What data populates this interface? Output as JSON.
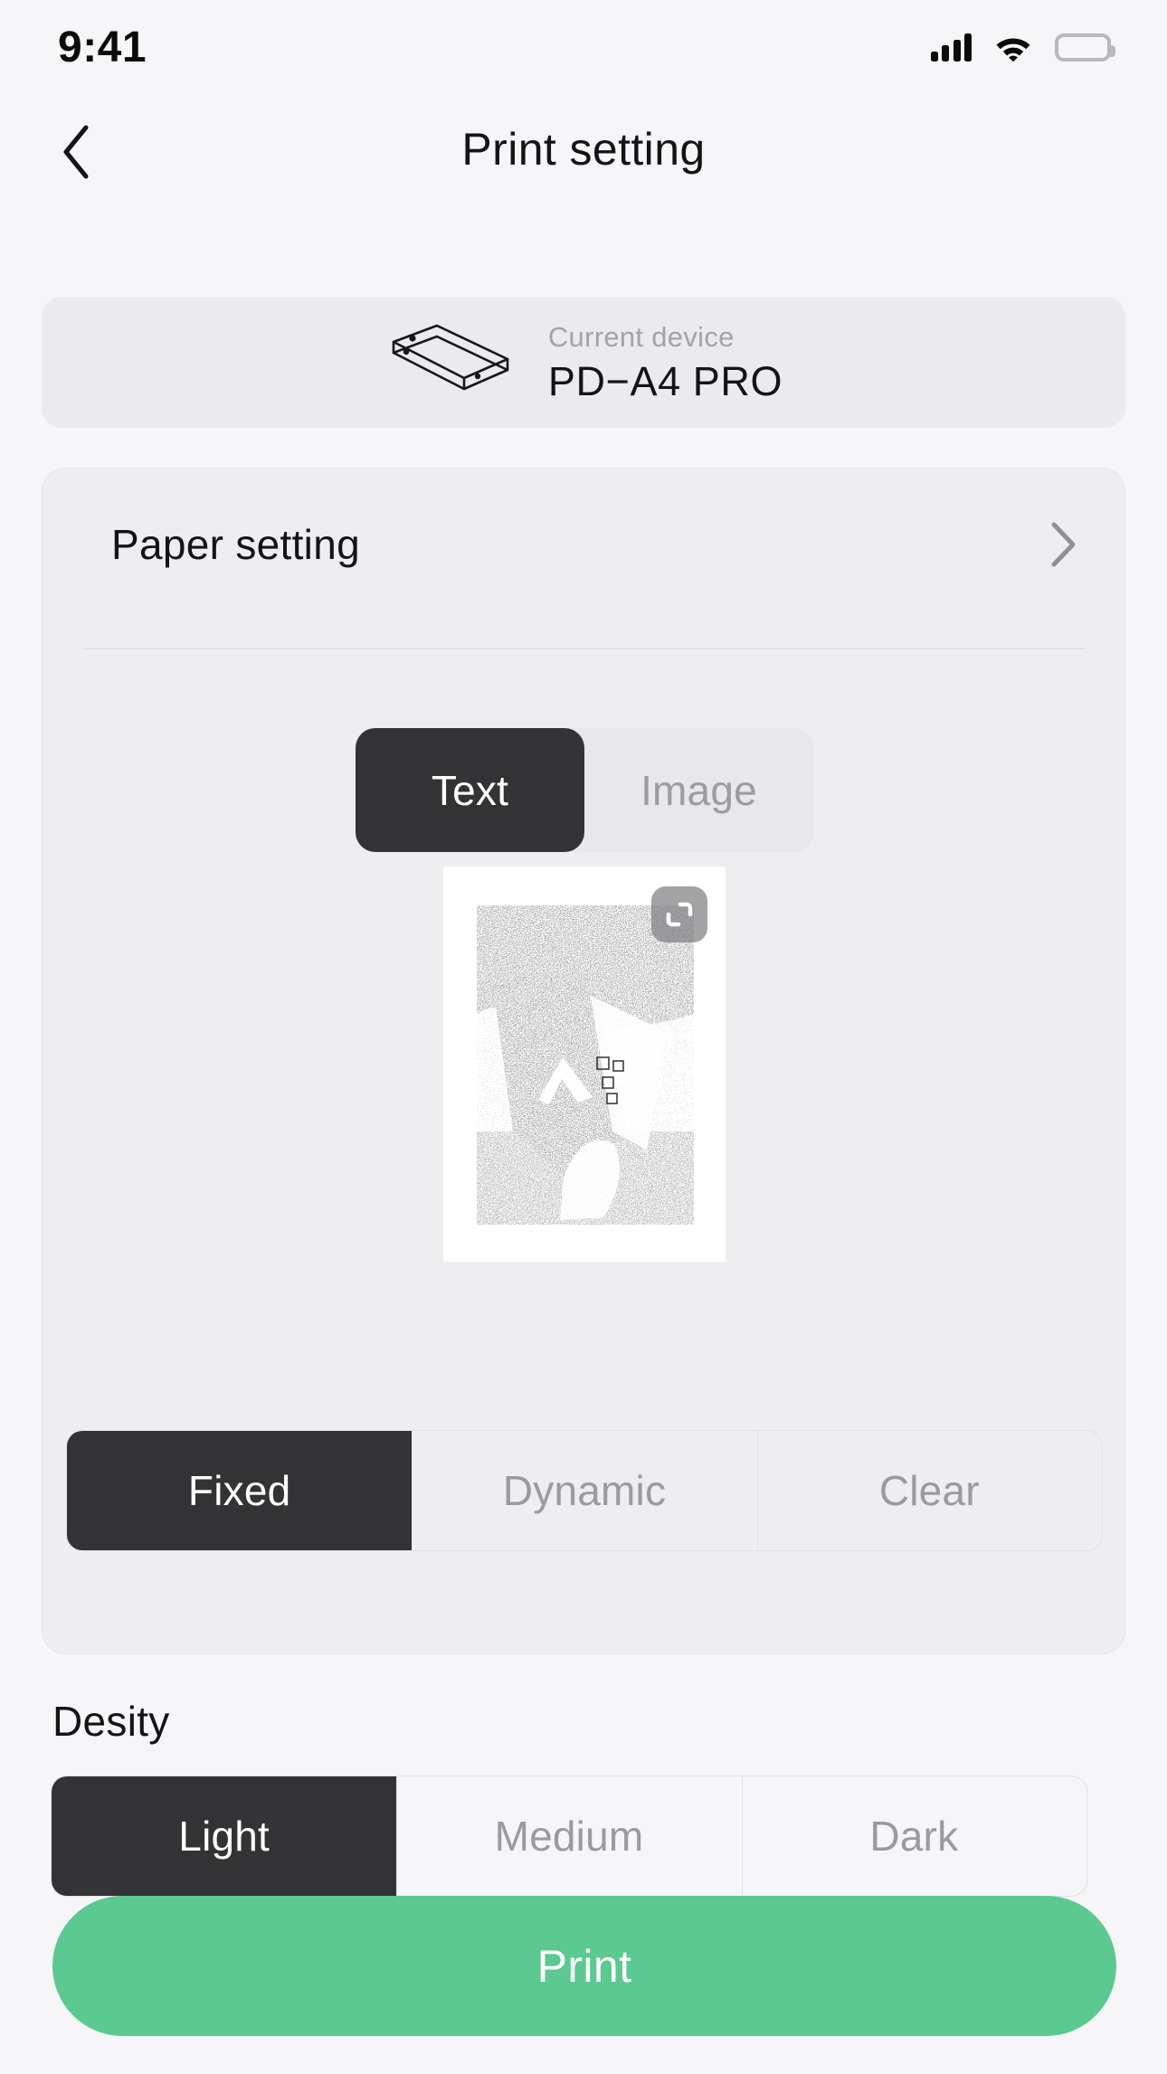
{
  "status_bar": {
    "time": "9:41",
    "signal_icon": "signal-bars-icon",
    "wifi_icon": "wifi-icon",
    "battery_icon": "battery-icon"
  },
  "nav": {
    "back_icon": "chevron-left-icon",
    "title": "Print setting"
  },
  "device": {
    "icon": "printer-device-icon",
    "label": "Current device",
    "name": "PD−A4 PRO"
  },
  "paper_setting": {
    "label": "Paper setting",
    "chevron_icon": "chevron-right-icon"
  },
  "content_tabs": {
    "selected": "Text",
    "items": [
      {
        "label": "Text",
        "selected": true
      },
      {
        "label": "Image",
        "selected": false
      }
    ]
  },
  "preview": {
    "crop_icon": "crop-icon"
  },
  "mode_segmented": {
    "selected": "Fixed",
    "items": [
      {
        "label": "Fixed",
        "selected": true
      },
      {
        "label": "Dynamic",
        "selected": false
      },
      {
        "label": "Clear",
        "selected": false
      }
    ]
  },
  "density": {
    "title": "Desity",
    "selected": "Light",
    "items": [
      {
        "label": "Light",
        "selected": true
      },
      {
        "label": "Medium",
        "selected": false
      },
      {
        "label": "Dark",
        "selected": false
      }
    ]
  },
  "print_button": {
    "label": "Print"
  },
  "colors": {
    "page_background": "#f6f6f8",
    "card_background": "#eeedf0",
    "device_card_background": "#ebebed",
    "selected_segment": "#333335",
    "accent_green": "#5cc991",
    "muted_text": "#9a9a9f",
    "primary_text": "#141417"
  }
}
